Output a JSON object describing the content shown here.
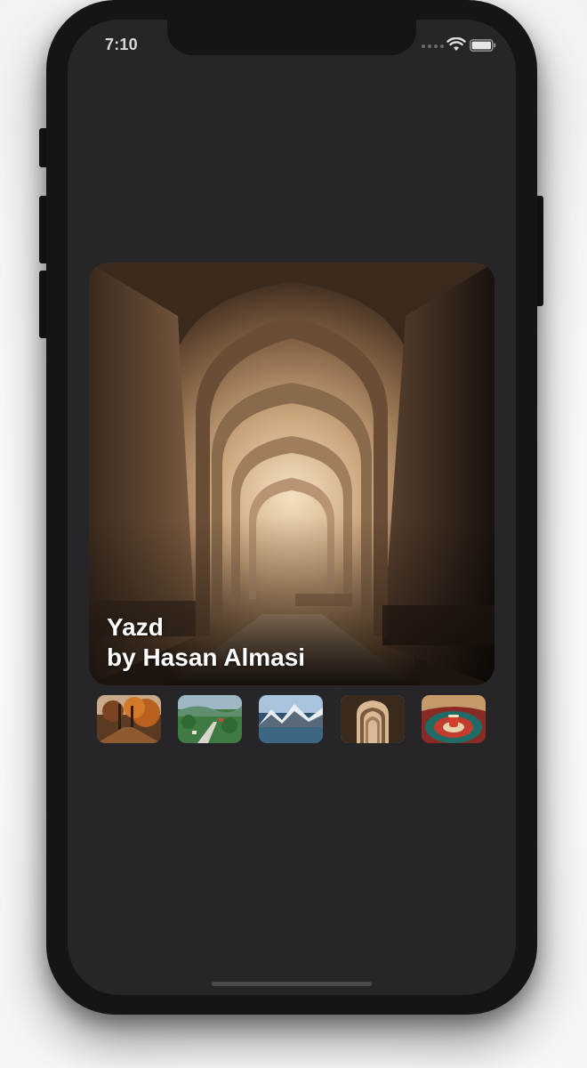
{
  "status_bar": {
    "time": "7:10",
    "icons": [
      "signal-dots-icon",
      "wifi-icon",
      "battery-icon"
    ]
  },
  "hero": {
    "title": "Yazd",
    "byline": "by Hasan Almasi"
  },
  "thumbnails": [
    {
      "name": "autumn-forest-road"
    },
    {
      "name": "green-valley-village"
    },
    {
      "name": "snowy-mountains-lake"
    },
    {
      "name": "yazd-arches"
    },
    {
      "name": "persian-tea-rug"
    }
  ],
  "colors": {
    "screen_background": "#262628",
    "text": "#ffffff"
  }
}
